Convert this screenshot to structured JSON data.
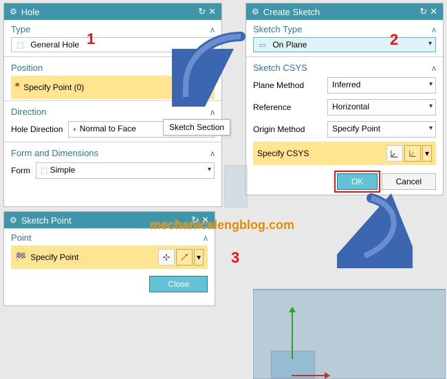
{
  "hole": {
    "title": "Hole",
    "type_label": "Type",
    "type_value": "General Hole",
    "position_label": "Position",
    "specify_point_label": "Specify Point (0)",
    "direction_label": "Direction",
    "hole_direction_label": "Hole Direction",
    "hole_direction_value": "Normal to Face",
    "form_label": "Form and Dimensions",
    "form_field_label": "Form",
    "form_value": "Simple",
    "tooltip": "Sketch Section"
  },
  "sketch": {
    "title": "Create Sketch",
    "sketch_type_label": "Sketch Type",
    "sketch_type_value": "On Plane",
    "csys_label": "Sketch CSYS",
    "plane_method_label": "Plane Method",
    "plane_method_value": "Inferred",
    "reference_label": "Reference",
    "reference_value": "Horizontal",
    "origin_method_label": "Origin Method",
    "origin_method_value": "Specify Point",
    "specify_csys_label": "Specify CSYS",
    "ok_label": "OK",
    "cancel_label": "Cancel"
  },
  "point": {
    "title": "Sketch Point",
    "section_label": "Point",
    "specify_label": "Specify Point",
    "close_label": "Close"
  },
  "labels": {
    "num1": "1",
    "num2": "2",
    "num3": "3"
  },
  "watermark": "mechanicalengblog.com"
}
